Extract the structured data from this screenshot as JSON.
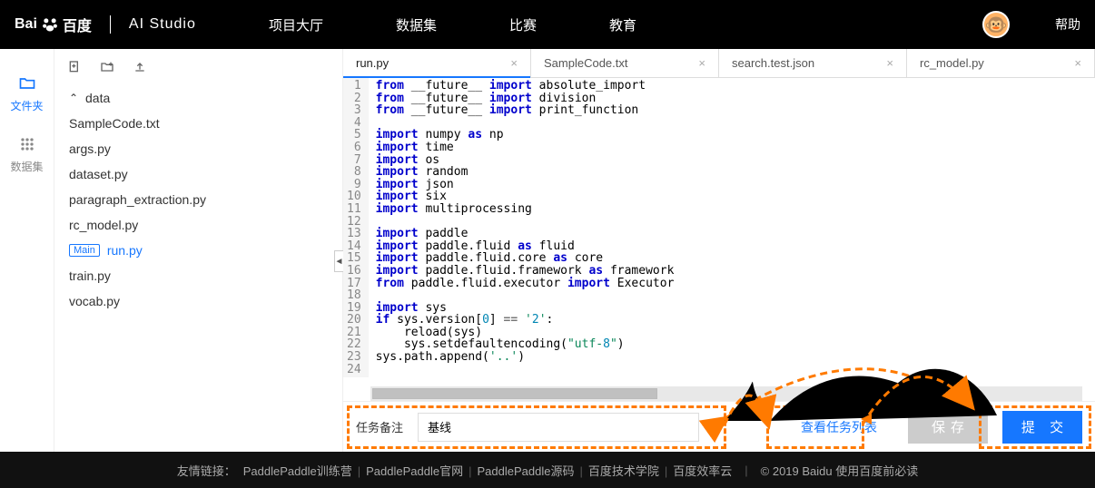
{
  "nav": {
    "brand_text": "Bai",
    "brand_text2": "百度",
    "sub_brand": "AI Studio",
    "links": [
      "项目大厅",
      "数据集",
      "比赛",
      "教育"
    ],
    "help": "帮助",
    "avatar_emoji": "🐵"
  },
  "rail": {
    "files": "文件夹",
    "datasets": "数据集"
  },
  "tree": {
    "folder": "data",
    "files": [
      {
        "name": "SampleCode.txt"
      },
      {
        "name": "args.py"
      },
      {
        "name": "dataset.py"
      },
      {
        "name": "paragraph_extraction.py"
      },
      {
        "name": "rc_model.py"
      },
      {
        "name": "run.py",
        "main": true,
        "active": true,
        "main_label": "Main"
      },
      {
        "name": "train.py"
      },
      {
        "name": "vocab.py"
      }
    ]
  },
  "tabs": [
    {
      "label": "run.py",
      "active": true
    },
    {
      "label": "SampleCode.txt"
    },
    {
      "label": "search.test.json"
    },
    {
      "label": "rc_model.py"
    }
  ],
  "code_lines": [
    "from __future__ import absolute_import",
    "from __future__ import division",
    "from __future__ import print_function",
    "",
    "import numpy as np",
    "import time",
    "import os",
    "import random",
    "import json",
    "import six",
    "import multiprocessing",
    "",
    "import paddle",
    "import paddle.fluid as fluid",
    "import paddle.fluid.core as core",
    "import paddle.fluid.framework as framework",
    "from paddle.fluid.executor import Executor",
    "",
    "import sys",
    "if sys.version[0] == '2':",
    "    reload(sys)",
    "    sys.setdefaultencoding(\"utf-8\")",
    "sys.path.append('..')",
    ""
  ],
  "bottom": {
    "label": "任务备注",
    "input_value": "基线",
    "view_queue": "查看任务列表",
    "save": "保存",
    "submit": "提 交"
  },
  "footer": {
    "prefix": "友情链接：",
    "links": [
      "PaddlePaddle训练营",
      "PaddlePaddle官网",
      "PaddlePaddle源码",
      "百度技术学院",
      "百度效率云"
    ],
    "copyright": "© 2019 Baidu 使用百度前必读"
  }
}
